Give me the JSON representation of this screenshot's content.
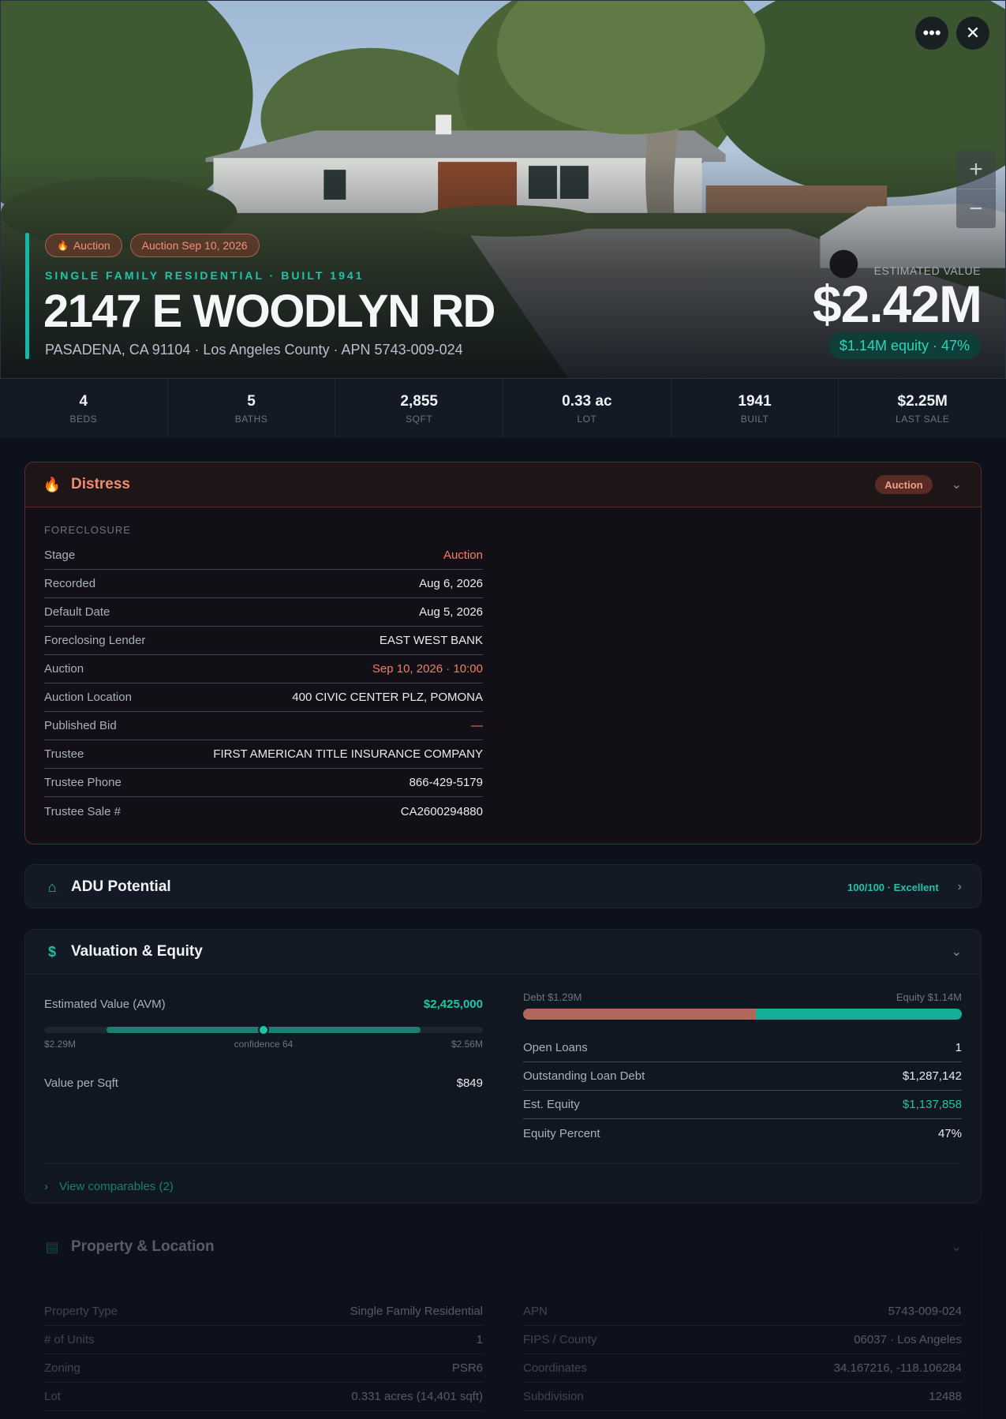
{
  "hero": {
    "chips": [
      {
        "label": "Auction",
        "icon": "flame-icon"
      },
      {
        "label": "Auction Sep 10, 2026"
      }
    ],
    "kicker": "SINGLE FAMILY RESIDENTIAL · BUILT 1941",
    "title": "2147 E WOODLYN RD",
    "subtitle": "PASADENA, CA 91104 · Los Angeles County · APN 5743-009-024",
    "estimated_label": "ESTIMATED VALUE",
    "estimated_value": "$2.42M",
    "equity_pill": "$1.14M equity · 47%",
    "more_icon": "ellipsis-icon",
    "close_icon": "close-icon",
    "zoom_in": "+",
    "zoom_out": "−"
  },
  "stats": [
    {
      "value": "4",
      "label": "BEDS"
    },
    {
      "value": "5",
      "label": "BATHS"
    },
    {
      "value": "2,855",
      "label": "SQFT"
    },
    {
      "value": "0.33 ac",
      "label": "LOT"
    },
    {
      "value": "1941",
      "label": "BUILT"
    },
    {
      "value": "$2.25M",
      "label": "LAST SALE"
    }
  ],
  "distress": {
    "title": "Distress",
    "badge": "Auction",
    "section": "FORECLOSURE",
    "rows": [
      {
        "k": "Stage",
        "v": "Auction"
      },
      {
        "k": "Recorded",
        "v": "Aug 6, 2026"
      },
      {
        "k": "Default Date",
        "v": "Aug 5, 2026"
      },
      {
        "k": "Foreclosing Lender",
        "v": "EAST WEST BANK"
      },
      {
        "k": "Auction",
        "v": "Sep 10, 2026 · 10:00"
      },
      {
        "k": "Auction Location",
        "v": "400 CIVIC CENTER PLZ, POMONA"
      },
      {
        "k": "Published Bid",
        "v": "—"
      },
      {
        "k": "Trustee",
        "v": "FIRST AMERICAN TITLE INSURANCE COMPANY"
      },
      {
        "k": "Trustee Phone",
        "v": "866-429-5179"
      },
      {
        "k": "Trustee Sale #",
        "v": "CA2600294880"
      }
    ]
  },
  "adu": {
    "title": "ADU Potential",
    "score": "100/100 · Excellent"
  },
  "valuation": {
    "title": "Valuation & Equity",
    "avm_label": "Estimated Value (AVM)",
    "avm_value": "$2,425,000",
    "range_low": "$2.29M",
    "range_high": "$2.56M",
    "confidence": "confidence 64",
    "range_low_value": 2290000,
    "range_high_value": 2560000,
    "avm_numeric": 2425000,
    "value_per_sqft_label": "Value per Sqft",
    "value_per_sqft": "$849",
    "debt_label": "Debt $1.29M",
    "equity_label": "Equity $1.14M",
    "debt_fraction": 0.53,
    "rows": [
      {
        "k": "Open Loans",
        "v": "1"
      },
      {
        "k": "Outstanding Loan Debt",
        "v": "$1,287,142"
      },
      {
        "k": "Est. Equity",
        "v": "$1,137,858"
      },
      {
        "k": "Equity Percent",
        "v": "47%"
      }
    ],
    "comparables": "View comparables (2)"
  },
  "property": {
    "title": "Property & Location",
    "left": [
      {
        "k": "Property Type",
        "v": "Single Family Residential"
      },
      {
        "k": "# of Units",
        "v": "1"
      },
      {
        "k": "Zoning",
        "v": "PSR6"
      },
      {
        "k": "Lot",
        "v": "0.331 acres (14,401 sqft)"
      }
    ],
    "right": [
      {
        "k": "APN",
        "v": "5743-009-024"
      },
      {
        "k": "FIPS / County",
        "v": "06037 · Los Angeles"
      },
      {
        "k": "Coordinates",
        "v": "34.167216, -118.106284"
      },
      {
        "k": "Subdivision",
        "v": "12488"
      }
    ]
  },
  "colors": {
    "accent": "#14b8a6",
    "distress": "#f07f63",
    "background": "#0c111b"
  }
}
